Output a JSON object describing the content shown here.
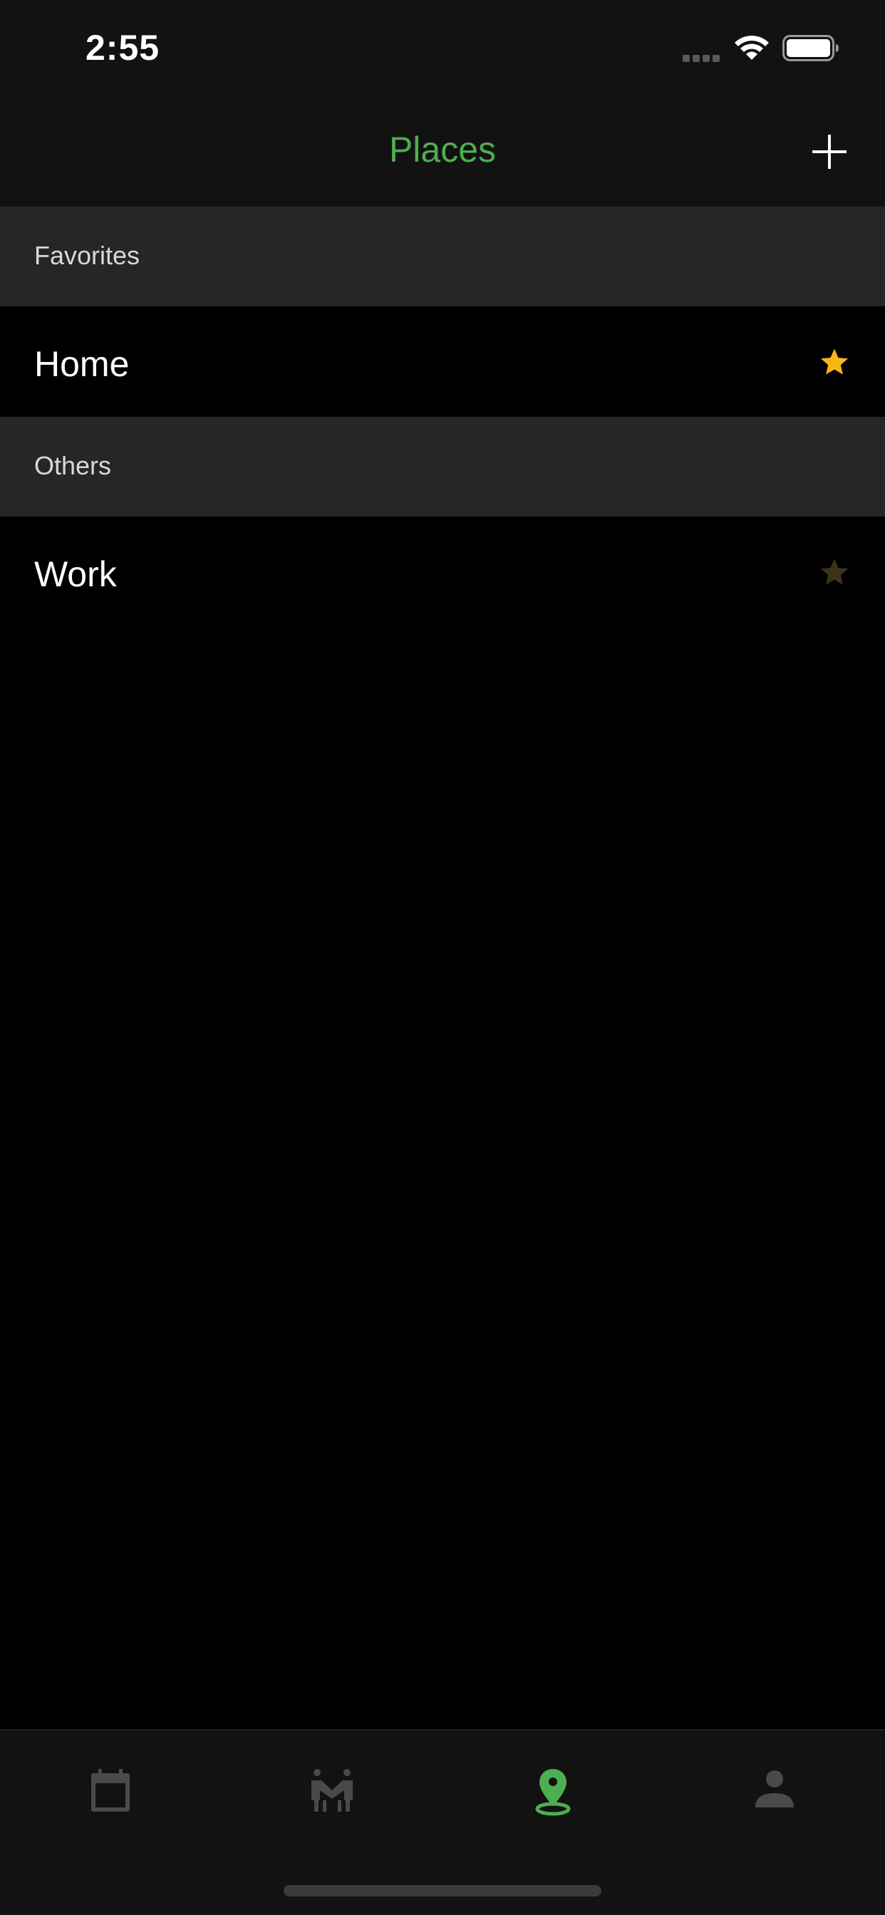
{
  "status_bar": {
    "time": "2:55"
  },
  "nav": {
    "title": "Places",
    "add_icon": "plus-icon"
  },
  "sections": [
    {
      "header": "Favorites",
      "items": [
        {
          "label": "Home",
          "favorite": true,
          "star_color": "#f5b716"
        }
      ]
    },
    {
      "header": "Others",
      "items": [
        {
          "label": "Work",
          "favorite": false,
          "star_color": "#3d3418"
        }
      ]
    }
  ],
  "tab_bar": {
    "tabs": [
      {
        "icon": "calendar-icon",
        "active": false
      },
      {
        "icon": "people-icon",
        "active": false
      },
      {
        "icon": "location-pin-icon",
        "active": true
      },
      {
        "icon": "person-icon",
        "active": false
      }
    ]
  },
  "colors": {
    "accent": "#4caf50",
    "tab_inactive": "#4a4a4a",
    "background": "#000000",
    "bar_background": "#121212",
    "section_header_bg": "#262626"
  }
}
